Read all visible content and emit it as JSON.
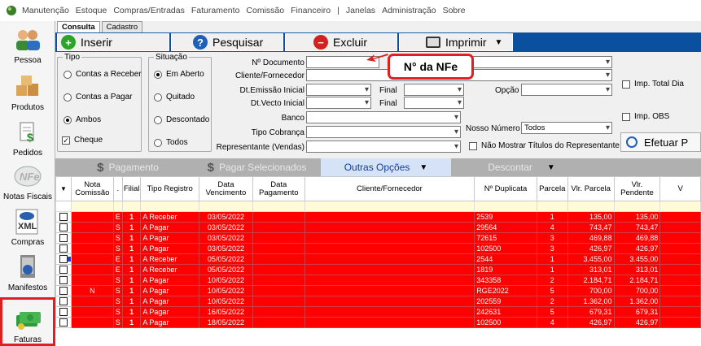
{
  "menu": [
    "Manutenção",
    "Estoque",
    "Compras/Entradas",
    "Faturamento",
    "Comissão",
    "Financeiro",
    "|",
    "Janelas",
    "Administração",
    "Sobre"
  ],
  "sidebar": [
    {
      "label": "Pessoa",
      "icon": "people-icon"
    },
    {
      "label": "Produtos",
      "icon": "boxes-icon"
    },
    {
      "label": "Pedidos",
      "icon": "order-doc-icon"
    },
    {
      "label": "Notas Fiscais",
      "icon": "nfe-icon"
    },
    {
      "label": "Compras",
      "icon": "xml-icon"
    },
    {
      "label": "Manifestos",
      "icon": "manifest-icon"
    },
    {
      "label": "Faturas",
      "icon": "money-icon"
    }
  ],
  "tabs": [
    "Consulta",
    "Cadastro"
  ],
  "toolbar": {
    "insert": "Inserir",
    "search": "Pesquisar",
    "delete": "Excluir",
    "print": "Imprimir"
  },
  "filters": {
    "tipo_title": "Tipo",
    "tipo": [
      "Contas a Receber",
      "Contas a Pagar",
      "Ambos"
    ],
    "situacao_title": "Situação",
    "situacao": [
      "Em Aberto",
      "Quitado",
      "Descontado",
      "Todos"
    ],
    "cheque": "Cheque",
    "labels": {
      "doc": "Nº Documento",
      "cliente": "Cliente/Fornecedor",
      "emissao": "Dt.Emissão Inicial",
      "vecto": "Dt.Vecto Inicial",
      "final1": "Final",
      "final2": "Final",
      "banco": "Banco",
      "cobranca": "Tipo Cobrança",
      "representante": "Representante (Vendas)",
      "opcao": "Opção",
      "nosso": "Nosso Número",
      "nosso_value": "Todos",
      "nao_mostrar": "Não Mostrar Títulos do Representante",
      "imp_total": "Imp. Total Dia",
      "imp_obs": "Imp. OBS",
      "efetuar": "Efetuar P"
    }
  },
  "callout": "N° da NFe",
  "actions": {
    "pagamento": "Pagamento",
    "pagar_sel": "Pagar Selecionados",
    "outras": "Outras Opções",
    "descontar": "Descontar"
  },
  "grid": {
    "headers": [
      "",
      "Nota Comissão",
      ".",
      "Filial",
      "Tipo Registro",
      "Data Vencimento",
      "Data Pagamento",
      "Cliente/Fornecedor",
      "Nº Duplicata",
      "Parcela",
      "Vlr. Parcela",
      "Vlr. Pendente",
      "V"
    ],
    "rows": [
      [
        "",
        "E",
        "1",
        "A Receber",
        "03/05/2022",
        "",
        "",
        "2539",
        "1",
        "135,00",
        "135,00"
      ],
      [
        "",
        "S",
        "1",
        "A Pagar",
        "03/05/2022",
        "",
        "",
        "29564",
        "4",
        "743,47",
        "743,47"
      ],
      [
        "",
        "S",
        "1",
        "A Pagar",
        "03/05/2022",
        "",
        "",
        "72615",
        "3",
        "469,88",
        "469,88"
      ],
      [
        "",
        "S",
        "1",
        "A Pagar",
        "03/05/2022",
        "",
        "",
        "102500",
        "3",
        "426,97",
        "426,97"
      ],
      [
        "",
        "E",
        "1",
        "A Receber",
        "05/05/2022",
        "",
        "",
        "2544",
        "1",
        "3.455,00",
        "3.455,00"
      ],
      [
        "",
        "E",
        "1",
        "A Receber",
        "05/05/2022",
        "",
        "",
        "1819",
        "1",
        "313,01",
        "313,01"
      ],
      [
        "",
        "S",
        "1",
        "A Pagar",
        "10/05/2022",
        "",
        "",
        "343358",
        "2",
        "2.184,71",
        "2.184,71"
      ],
      [
        "N",
        "S",
        "1",
        "A Pagar",
        "10/05/2022",
        "",
        "",
        "RGE2022",
        "5",
        "700,00",
        "700,00"
      ],
      [
        "",
        "S",
        "1",
        "A Pagar",
        "10/05/2022",
        "",
        "",
        "202559",
        "2",
        "1.362,00",
        "1.362,00"
      ],
      [
        "",
        "S",
        "1",
        "A Pagar",
        "16/05/2022",
        "",
        "",
        "242631",
        "5",
        "679,31",
        "679,31"
      ],
      [
        "",
        "S",
        "1",
        "A Pagar",
        "18/05/2022",
        "",
        "",
        "102500",
        "4",
        "426,97",
        "426,97"
      ]
    ]
  }
}
